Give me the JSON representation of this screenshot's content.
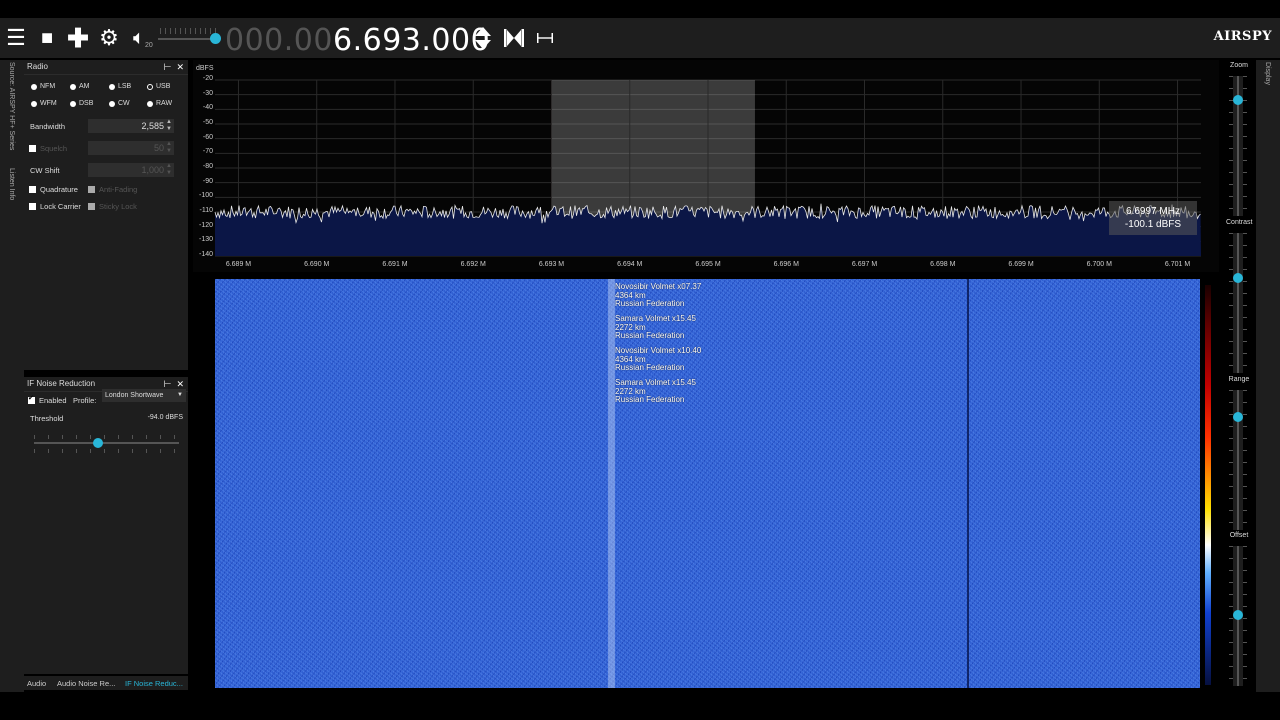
{
  "toolbar": {
    "menu_icon": "hamburger-menu-icon",
    "stop_icon": "stop-icon",
    "add_icon": "plus-icon",
    "settings_icon": "gear-icon",
    "volume_icon": "speaker-icon",
    "volume_value": "20",
    "frequency_dim": "000.00",
    "frequency_bright": "6.693.000",
    "tune_icon": "up-down-arrows-icon",
    "snap_icon": "skip-center-icon",
    "span_icon": "span-width-icon",
    "logo": "AIRSPY"
  },
  "left_strip": {
    "source_label": "Source: AIRSPY HF+ Series",
    "listen_label": "Listen Info"
  },
  "right_strip": {
    "display_label": "Display"
  },
  "radio_panel": {
    "title": "Radio",
    "modes_row1": [
      "NFM",
      "AM",
      "LSB",
      "USB"
    ],
    "modes_row2": [
      "WFM",
      "DSB",
      "CW",
      "RAW"
    ],
    "selected_mode": "USB",
    "bandwidth_label": "Bandwidth",
    "bandwidth_value": "2,585",
    "squelch_label": "Squelch",
    "squelch_value": "50",
    "cw_shift_label": "CW Shift",
    "cw_shift_value": "1,000",
    "quadrature_label": "Quadrature",
    "anti_fading_label": "Anti-Fading",
    "lock_carrier_label": "Lock Carrier",
    "sticky_lock_label": "Sticky Lock"
  },
  "nr_panel": {
    "title": "IF Noise Reduction",
    "enabled_label": "Enabled",
    "enabled": true,
    "profile_label": "Profile:",
    "profile_value": "London Shortwave",
    "threshold_label": "Threshold",
    "threshold_value": "-94.0 dBFS",
    "threshold_fraction": 0.44
  },
  "bottom_tabs": [
    "Audio",
    "Audio Noise Re...",
    "IF Noise Reduc..."
  ],
  "spectrum": {
    "unit_label": "dBFS",
    "y_ticks": [
      "-20",
      "-30",
      "-40",
      "-50",
      "-60",
      "-70",
      "-80",
      "-90",
      "-100",
      "-110",
      "-120",
      "-130",
      "-140"
    ],
    "x_ticks": [
      "6.689 M",
      "6.690 M",
      "6.691 M",
      "6.692 M",
      "6.693 M",
      "6.694 M",
      "6.695 M",
      "6.696 M",
      "6.697 M",
      "6.698 M",
      "6.699 M",
      "6.700 M",
      "6.701 M"
    ],
    "cursor_freq": "6.6997 MHz",
    "cursor_level": "-100.1 dBFS",
    "noise_floor_dbfs": -110,
    "passband_mhz": [
      6.693,
      6.6956
    ]
  },
  "waterfall": {
    "annotations": [
      [
        "Novosibir Volmet x07.37",
        "4364 km",
        "Russian Federation"
      ],
      [
        "Samara Volmet x15.45",
        "2272 km",
        "Russian Federation"
      ],
      [
        "Novosibir Volmet x10.40",
        "4364 km",
        "Russian Federation"
      ],
      [
        "Samara Volmet x15.45",
        "2272 km",
        "Russian Federation"
      ]
    ]
  },
  "display_sliders": [
    {
      "label": "Zoom",
      "value": 0.15
    },
    {
      "label": "Contrast",
      "value": 0.45
    },
    {
      "label": "Range",
      "value": 0.2
    },
    {
      "label": "Offset",
      "value": 0.8
    }
  ],
  "colors": {
    "accent": "#29b6d8",
    "panel_bg": "#1e1e1e",
    "waterfall_blue": "#2f5fd2",
    "spectrum_fill": "#0b1646"
  }
}
